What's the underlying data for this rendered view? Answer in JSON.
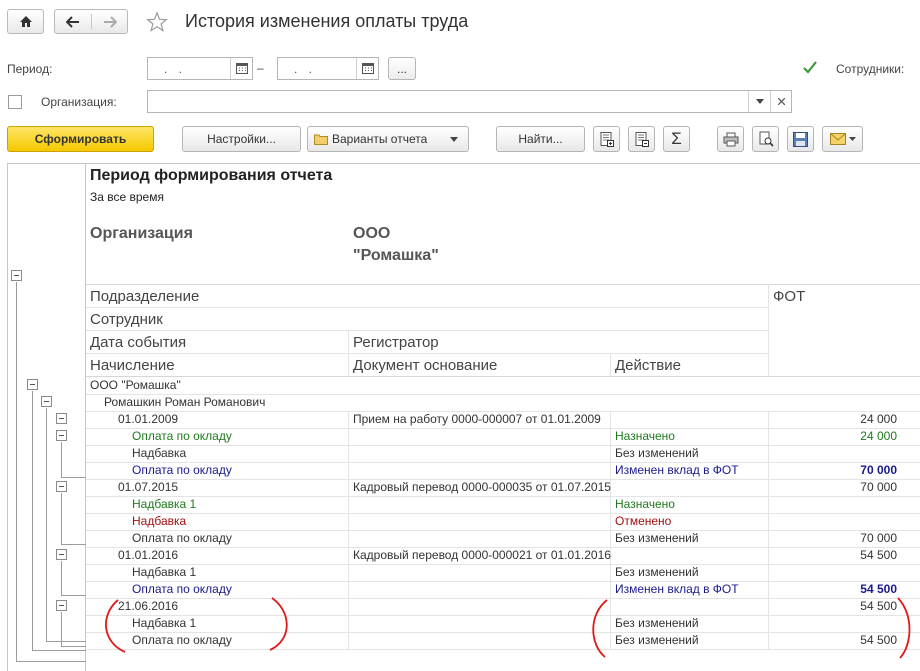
{
  "window": {
    "title": "История изменения оплаты труда"
  },
  "form": {
    "period_label": "Период:",
    "period_from": ". .",
    "period_dash": "–",
    "period_to": ". .",
    "period_more": "...",
    "employees_label": "Сотрудники:",
    "employees_checked": true,
    "org_label": "Организация:",
    "org_value": "",
    "org_checked": false
  },
  "toolbar": {
    "generate": "Сформировать",
    "settings": "Настройки...",
    "variants": "Варианты отчета",
    "find": "Найти..."
  },
  "report": {
    "period_title": "Период формирования отчета",
    "period_value": "За все время",
    "org_label": "Организация",
    "org_name_line1": "ООО",
    "org_name_line2": "\"Ромашка\"",
    "headers": {
      "division": "Подразделение",
      "fot": "ФОТ",
      "employee": "Сотрудник",
      "event_date": "Дата события",
      "registrar": "Регистратор",
      "accrual": "Начисление",
      "basis_doc": "Документ основание",
      "action": "Действие"
    },
    "rows": [
      {
        "c1": "ООО \"Ромашка\"",
        "c2": "",
        "c3": "",
        "c4": "",
        "color": "#333333",
        "bold4": false
      },
      {
        "c1": "Ромашкин Роман Романович",
        "c2": "",
        "c3": "",
        "c4": "",
        "color": "#333333",
        "bold4": false
      },
      {
        "c1": "01.01.2009",
        "c2": "Прием на работу 0000-000007 от 01.01.2009",
        "c3": "",
        "c4": "24 000",
        "color": "#333333",
        "bold4": false
      },
      {
        "c1": "Оплата по окладу",
        "c2": "",
        "c3": "Назначено",
        "c4": "24 000",
        "color": "#1e7a1e",
        "bold4": false
      },
      {
        "c1": "Надбавка",
        "c2": "",
        "c3": "Без изменений",
        "c4": "",
        "color": "#333333",
        "bold4": false
      },
      {
        "c1": "Оплата по окладу",
        "c2": "",
        "c3": "Изменен вклад в ФОТ",
        "c4": "70 000",
        "color": "#1a1a8c",
        "bold4": true
      },
      {
        "c1": "01.07.2015",
        "c2": "Кадровый перевод 0000-000035 от 01.07.2015",
        "c3": "",
        "c4": "70 000",
        "color": "#333333",
        "bold4": false
      },
      {
        "c1": "Надбавка 1",
        "c2": "",
        "c3": "Назначено",
        "c4": "",
        "color": "#1e7a1e",
        "bold4": false
      },
      {
        "c1": "Надбавка",
        "c2": "",
        "c3": "Отменено",
        "c4": "",
        "color": "#a01010",
        "bold4": false
      },
      {
        "c1": "Оплата по окладу",
        "c2": "",
        "c3": "Без изменений",
        "c4": "70 000",
        "color": "#333333",
        "bold4": false
      },
      {
        "c1": "01.01.2016",
        "c2": "Кадровый перевод 0000-000021 от 01.01.2016",
        "c3": "",
        "c4": "54 500",
        "color": "#333333",
        "bold4": false
      },
      {
        "c1": "Надбавка 1",
        "c2": "",
        "c3": "Без изменений",
        "c4": "",
        "color": "#333333",
        "bold4": false
      },
      {
        "c1": "Оплата по окладу",
        "c2": "",
        "c3": "Изменен вклад в ФОТ",
        "c4": "54 500",
        "color": "#1a1a8c",
        "bold4": true
      },
      {
        "c1": "21.06.2016",
        "c2": "",
        "c3": "",
        "c4": "54 500",
        "color": "#333333",
        "bold4": false
      },
      {
        "c1": "Надбавка 1",
        "c2": "",
        "c3": "Без изменений",
        "c4": "",
        "color": "#333333",
        "bold4": false
      },
      {
        "c1": "Оплата по окладу",
        "c2": "",
        "c3": "Без изменений",
        "c4": "54 500",
        "color": "#333333",
        "bold4": false
      }
    ]
  },
  "icons": {
    "home": "home-icon",
    "back": "arrow-left-icon",
    "forward": "arrow-right-icon",
    "favorite": "star-icon",
    "calendar": "calendar-icon",
    "dropdown": "chevron-down-icon",
    "clear": "close-icon",
    "folder": "folder-icon",
    "sum": "sigma-icon",
    "print": "printer-icon",
    "preview": "preview-icon",
    "save": "floppy-icon",
    "mail": "envelope-icon"
  },
  "colors": {
    "primary_button": "#f5c900",
    "assigned": "#1e7a1e",
    "canceled": "#a01010",
    "changed": "#1a1a8c",
    "annotation": "#e01818"
  }
}
